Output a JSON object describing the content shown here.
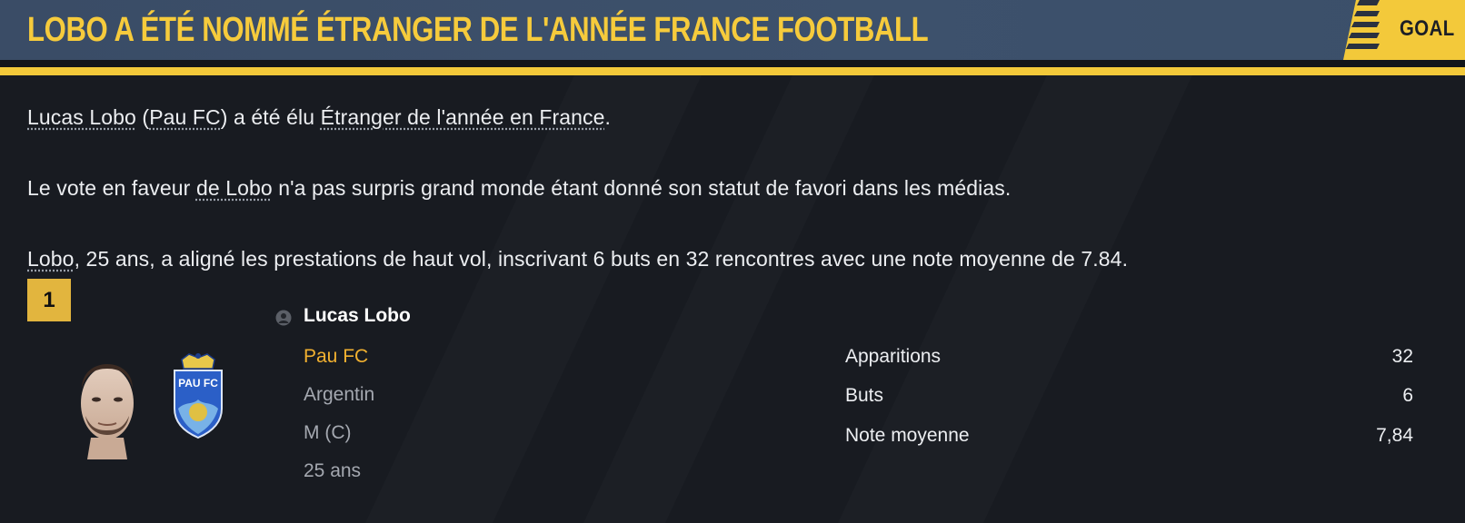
{
  "header": {
    "headline": "LOBO A ÉTÉ NOMMÉ ÉTRANGER DE L'ANNÉE FRANCE FOOTBALL",
    "brand": "GOAL"
  },
  "article": {
    "p1": {
      "player_link": "Lucas Lobo",
      "t1": " (",
      "club_link": "Pau FC",
      "t2": ") a été élu ",
      "award_link": "Étranger de l'année en France",
      "t3": "."
    },
    "p2": {
      "t1": "Le vote en faveur ",
      "link": "de Lobo",
      "t2": " n'a pas surpris grand monde étant donné son statut de favori dans les médias."
    },
    "p3": {
      "link": "Lobo",
      "t1": ", 25 ans, a aligné les prestations de haut vol, inscrivant 6 buts en 32 rencontres avec une note moyenne de 7.84."
    }
  },
  "player_card": {
    "rank": "1",
    "name": "Lucas Lobo",
    "club": "Pau FC",
    "nationality": "Argentin",
    "position": "M (C)",
    "age": "25 ans",
    "crest_text": "PAU FC",
    "icons": [
      "person-icon",
      "player-face",
      "club-crest"
    ],
    "stats": [
      {
        "label": "Apparitions",
        "value": "32"
      },
      {
        "label": "Buts",
        "value": "6"
      },
      {
        "label": "Note moyenne",
        "value": "7,84"
      }
    ]
  },
  "colors": {
    "accent_yellow": "#f3c93a",
    "header_blue": "#3b4f69",
    "club_orange": "#f2b130",
    "background": "#181b21"
  }
}
